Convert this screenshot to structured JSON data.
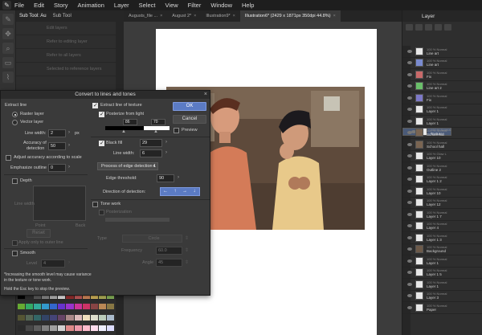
{
  "menubar": {
    "items": [
      "File",
      "Edit",
      "Story",
      "Animation",
      "Layer",
      "Select",
      "View",
      "Filter",
      "Window",
      "Help"
    ]
  },
  "subtool": {
    "tabs": [
      "Sub Tool: Au",
      "Sub Tool"
    ],
    "rows": [
      "Edit layers",
      "Refer to editing layer",
      "Refer to all layers",
      "Selected to reference layers"
    ]
  },
  "doctabs": [
    {
      "label": "Augusts_file ..."
    },
    {
      "label": "August 2*"
    },
    {
      "label": "Illustration9*"
    },
    {
      "label": "Illustration6* (2429 x 1871px 350dpi 44.8%)"
    }
  ],
  "layers": {
    "title": "Layer",
    "rows": [
      {
        "a": "100 % Normal",
        "b": "Line art"
      },
      {
        "a": "100 % Normal",
        "b": "Line art"
      },
      {
        "a": "100 % Normal",
        "b": "Fix"
      },
      {
        "a": "100 % Normal",
        "b": "Line art 2"
      },
      {
        "a": "100 % Normal",
        "b": "Fix"
      },
      {
        "a": "100 % Normal",
        "b": "Layer 1"
      },
      {
        "a": "100 % Normal",
        "b": "Layer 1"
      },
      {
        "a": "100 % Normal",
        "b": "Texture"
      },
      {
        "a": "100 % Normal",
        "b": "School hall"
      },
      {
        "a": "100 % Normal",
        "b": "School hall"
      },
      {
        "a": "100 % Glow L",
        "b": "Layer 10"
      },
      {
        "a": "100 % Normal",
        "b": "Outline 2"
      },
      {
        "a": "100 % Normal",
        "b": "Layer 1 2"
      },
      {
        "a": "100 % Normal",
        "b": "Layer 10"
      },
      {
        "a": "100 % Normal",
        "b": "Layer 12"
      },
      {
        "a": "100 % Normal",
        "b": "Layer 1 7"
      },
      {
        "a": "100 % Normal",
        "b": "Layer 4"
      },
      {
        "a": "100 % Normal",
        "b": "Layer 1 3"
      },
      {
        "a": "100 % Normal",
        "b": "Background"
      },
      {
        "a": "100 % Normal",
        "b": "Layer 1"
      },
      {
        "a": "100 % Normal",
        "b": "Layer 1 5"
      },
      {
        "a": "100 % Normal",
        "b": "Layer 1"
      },
      {
        "a": "100 % Normal",
        "b": "Layer 3"
      },
      {
        "a": "100 % Normal",
        "b": "Paper"
      }
    ]
  },
  "dialog": {
    "title": "Convert to lines and tones",
    "ok": "OK",
    "cancel": "Cancel",
    "preview": "Preview",
    "extract_line": {
      "heading": "Extract line",
      "raster": "Raster layer",
      "vector": "Vector layer",
      "line_width_label": "Line width:",
      "line_width": "2",
      "unit": "px",
      "accuracy_label_1": "Accuracy of",
      "accuracy_label_2": "detection",
      "accuracy": "50",
      "adjust_label": "Adjust accuracy according to scale",
      "emphasize_label": "Emphasize outline",
      "emphasize": "0",
      "depth_label": "Depth",
      "line_width_graph": "Line width",
      "point": "Point",
      "back": "Back",
      "reset": "Reset",
      "apply_outer": "Apply only to outer line",
      "smooth_label": "Smooth",
      "level_label": "Level",
      "level": "4"
    },
    "extract_texture": {
      "heading": "Extract line of texture",
      "posterize_label": "Posterize from light",
      "posterize_low": "86",
      "posterize_high": "70",
      "black_fill_label": "Black fill",
      "black_fill": "29",
      "line_width_label": "Line width:",
      "line_width": "6",
      "process_select": "Process of edge detection 1",
      "edge_threshold_label": "Edge threshold:",
      "edge_threshold": "90",
      "direction_label": "Direction of detection:"
    },
    "tone_work": {
      "heading": "Tone work",
      "posterization": "Posterization",
      "type_label": "Type",
      "type": "Circle",
      "frequency_label": "Frequency",
      "frequency": "60.0",
      "angle_label": "Angle",
      "angle": "45"
    },
    "note_1": "*Increasing the smooth level may cause variance",
    "note_2": "in the texture or tone work.",
    "note_3": "Hold the Esc key to stop the preview."
  },
  "colors": {
    "accent": "#5b7bc4",
    "selected_layer": "#4a5a78"
  }
}
